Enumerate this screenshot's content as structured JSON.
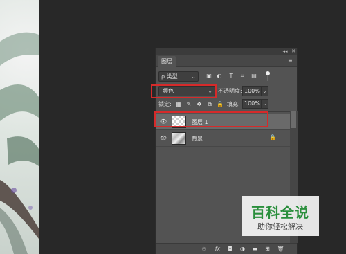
{
  "panel": {
    "collapse_glyph": "◂◂",
    "close_glyph": "✕",
    "tab_label": "图层",
    "menu_glyph": "≡"
  },
  "filter": {
    "kind_label": "ρ 类型",
    "caret": "⌄",
    "icons": {
      "pixel": "▣",
      "adjustment": "◐",
      "type": "T",
      "shape": "⌗",
      "smart": "▤"
    }
  },
  "blend": {
    "mode": "颜色",
    "caret": "⌄",
    "opacity_label": "不透明度:",
    "opacity_value": "100%",
    "stepper": "⌄"
  },
  "lock": {
    "label": "锁定:",
    "icons": {
      "transparent_pixels": "▦",
      "image_pixels": "✎",
      "position": "✥",
      "artboard": "⧉",
      "all": "🔒"
    },
    "fill_label": "填充:",
    "fill_value": "100%",
    "stepper": "⌄"
  },
  "layers": [
    {
      "name": "图层 1",
      "selected": true,
      "eye": "👁",
      "thumb": "transparent",
      "locked": false
    },
    {
      "name": "背景",
      "selected": false,
      "eye": "👁",
      "thumb": "photo",
      "locked": true,
      "lock_glyph": "🔒"
    }
  ],
  "footer": {
    "link": "⊖",
    "fx": "fx",
    "mask": "◘",
    "adjustment": "◑",
    "group": "▬",
    "new_layer": "⊞",
    "delete": "🗑"
  },
  "watermark": {
    "title": "百科全说",
    "subtitle": "助你轻松解决"
  },
  "colors": {
    "highlight": "#d62a2a",
    "watermark_green": "#2a8f3c"
  }
}
